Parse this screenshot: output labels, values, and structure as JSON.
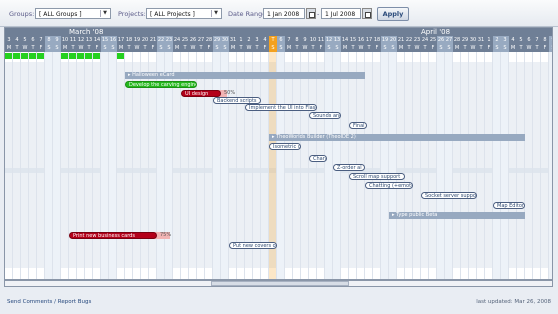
{
  "filters": {
    "groups_label": "Groups:",
    "groups_value": "[ ALL Groups ]",
    "projects_label": "Projects:",
    "projects_value": "[ ALL Projects ]",
    "date_range_label": "Date Range",
    "start_date": "1 Jan 2008",
    "end_date": "1 Jul 2008",
    "separator": "-",
    "apply_label": "Apply"
  },
  "timeline": {
    "months": [
      "March '08",
      "April '08"
    ],
    "first_day": 3,
    "last_day": 30,
    "highlight_day": "T",
    "tasks": [
      {
        "label": "Halloween eCard",
        "type": "summary",
        "start": 15,
        "end": 45
      },
      {
        "label": "Develop the carving engine",
        "type": "green",
        "start": 15,
        "end": 24
      },
      {
        "label": "UI design",
        "type": "red",
        "start": 22,
        "end": 27,
        "progress": "50%"
      },
      {
        "label": "Backend scripts",
        "type": "task",
        "start": 26,
        "end": 32
      },
      {
        "label": "Implement the UI into Flash",
        "type": "task",
        "start": 30,
        "end": 39
      },
      {
        "label": "Sounds and",
        "type": "task",
        "start": 38,
        "end": 42
      },
      {
        "label": "Final",
        "type": "task",
        "start": 43,
        "end": 45
      },
      {
        "label": "TheoWorlds Builder (TheoIDE 2)",
        "type": "summary",
        "start": 33,
        "end": 65
      },
      {
        "label": "Isometric c",
        "type": "task",
        "start": 33,
        "end": 37
      },
      {
        "label": "Chara",
        "type": "task",
        "start": 38,
        "end": 40
      },
      {
        "label": "Z-order al",
        "type": "task",
        "start": 41,
        "end": 45
      },
      {
        "label": "Scroll map support",
        "type": "task",
        "start": 43,
        "end": 50
      },
      {
        "label": "Chatting (+emoticon)",
        "type": "task",
        "start": 45,
        "end": 51
      },
      {
        "label": "Socket server support",
        "type": "task",
        "start": 52,
        "end": 59
      },
      {
        "label": "Map Editor",
        "type": "task",
        "start": 61,
        "end": 65
      },
      {
        "label": "Type public Beta",
        "type": "summary",
        "start": 48,
        "end": 65
      },
      {
        "label": "Print new business cards",
        "type": "red",
        "start": 8,
        "end": 19,
        "progress": "75%"
      },
      {
        "label": "Put new covers on",
        "type": "task",
        "start": 28,
        "end": 34
      }
    ]
  },
  "footer": {
    "link": "Send Comments / Report Bugs",
    "updated": "last updated: Mar 26, 2008"
  }
}
